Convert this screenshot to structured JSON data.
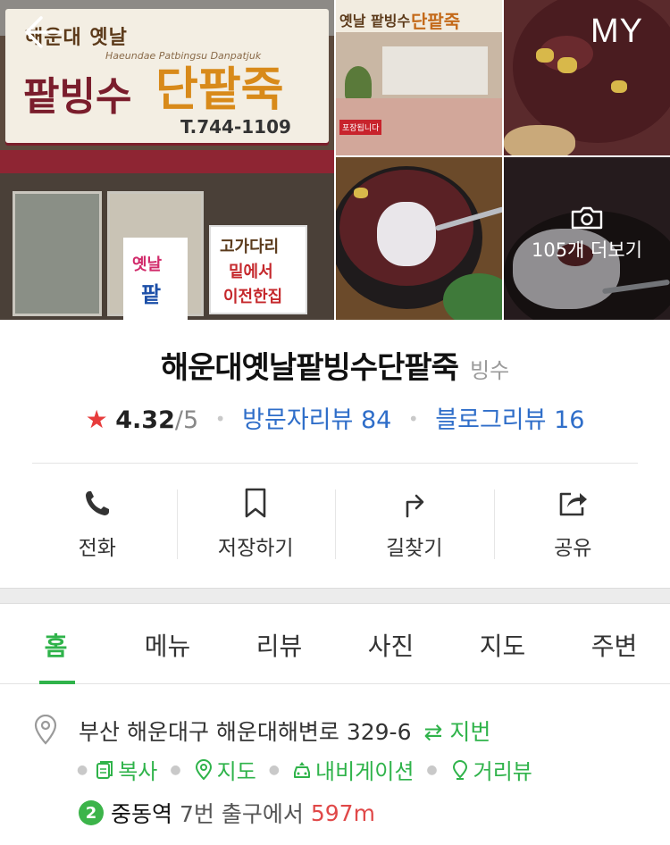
{
  "header": {
    "my_label": "MY",
    "more_photos_label": "105개 더보기",
    "storefront": {
      "sign_top": "해운대 옛날",
      "sign_eng": "Haeundae Patbingsu Danpatjuk",
      "sign_main1": "팥빙수",
      "sign_main2": "단팥죽",
      "sign_tel": "T.744-1109",
      "poster_right": [
        "고가다리",
        "밑에서",
        "이전한집"
      ],
      "poster_left": [
        "옛날",
        "팥"
      ]
    },
    "interior": {
      "banner1": "옛날 팥빙수",
      "banner2": "단팥죽",
      "label": "포장됩니다"
    }
  },
  "place": {
    "name": "해운대옛날팥빙수단팥죽",
    "category": "빙수",
    "rating": "4.32",
    "rating_max": "/5",
    "visitor_reviews": "방문자리뷰 84",
    "blog_reviews": "블로그리뷰 16"
  },
  "actions": [
    {
      "label": "전화",
      "icon": "phone-icon"
    },
    {
      "label": "저장하기",
      "icon": "bookmark-icon"
    },
    {
      "label": "길찾기",
      "icon": "directions-icon"
    },
    {
      "label": "공유",
      "icon": "share-icon"
    }
  ],
  "tabs": [
    {
      "label": "홈",
      "active": true
    },
    {
      "label": "메뉴"
    },
    {
      "label": "리뷰"
    },
    {
      "label": "사진"
    },
    {
      "label": "지도"
    },
    {
      "label": "주변"
    }
  ],
  "info": {
    "address": "부산 해운대구 해운대해변로 329-6",
    "jibun_label": "⇄ 지번",
    "links": [
      {
        "label": "복사",
        "icon": "copy-icon"
      },
      {
        "label": "지도",
        "icon": "map-pin-icon"
      },
      {
        "label": "내비게이션",
        "icon": "car-icon"
      },
      {
        "label": "거리뷰",
        "icon": "streetview-icon"
      }
    ],
    "subway": {
      "line": "2",
      "station": "중동역",
      "exit": "7번 출구에서",
      "distance": "597m",
      "line_color": "#3cb44a"
    }
  },
  "colors": {
    "accent": "#2fb34a",
    "link": "#2f6ec9",
    "star": "#e73c3c",
    "distance": "#e04848"
  }
}
